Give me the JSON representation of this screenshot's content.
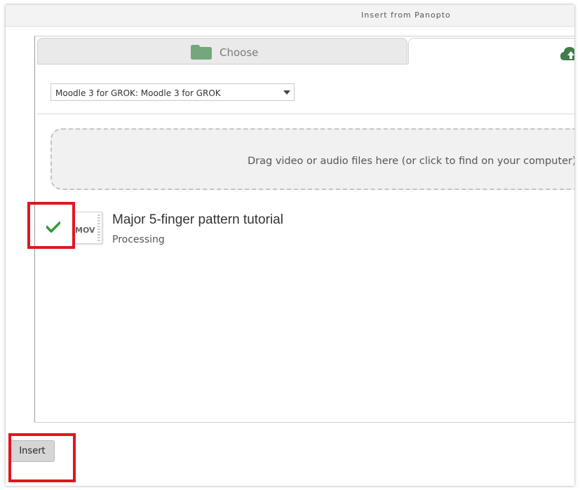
{
  "window": {
    "title": "Insert from Panopto"
  },
  "tabs": {
    "choose": {
      "label": "Choose",
      "icon": "folder-icon"
    },
    "upload": {
      "icon": "cloud-upload-icon"
    }
  },
  "folder_select": {
    "selected": "Moodle 3 for GROK: Moodle 3 for GROK"
  },
  "dropzone": {
    "text": "Drag video or audio files here (or click to find on your computer)"
  },
  "upload_item": {
    "status_icon": "check-icon",
    "file_type": "MOV",
    "title": "Major 5-finger pattern tutorial",
    "status": "Processing"
  },
  "footer": {
    "insert_label": "Insert"
  },
  "colors": {
    "accent_green": "#5a9a63",
    "check_green": "#2e9a3a",
    "highlight_red": "#e0161f"
  }
}
